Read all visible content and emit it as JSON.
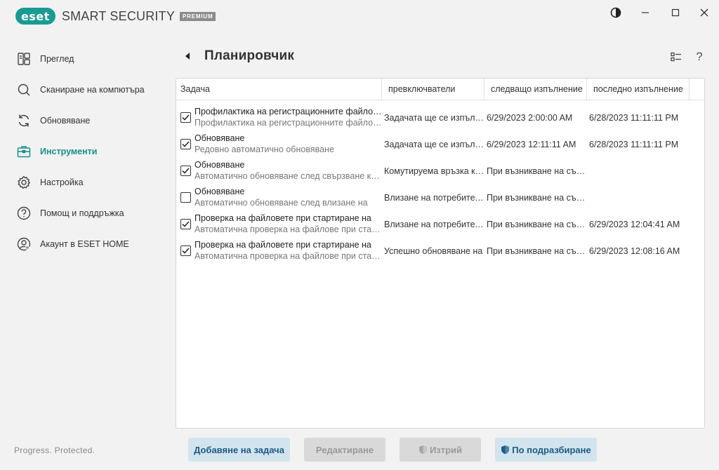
{
  "app": {
    "logo_mark": "eset",
    "product_name": "SMART SECURITY",
    "edition_badge": "PREMIUM",
    "accent_color": "#1a9a92"
  },
  "window_controls": {
    "theme_icon": "contrast-icon",
    "minimize_icon": "minimize-icon",
    "maximize_icon": "maximize-icon",
    "close_icon": "close-icon"
  },
  "sidebar": {
    "items": [
      {
        "label": "Преглед",
        "icon": "overview-icon",
        "active": false
      },
      {
        "label": "Сканиране на компютъра",
        "icon": "search-icon",
        "active": false
      },
      {
        "label": "Обновяване",
        "icon": "refresh-icon",
        "active": false
      },
      {
        "label": "Инструменти",
        "icon": "toolbox-icon",
        "active": true
      },
      {
        "label": "Настройка",
        "icon": "gear-icon",
        "active": false
      },
      {
        "label": "Помощ и поддръжка",
        "icon": "help-icon",
        "active": false
      },
      {
        "label": "Акаунт в ESET HOME",
        "icon": "account-icon",
        "active": false
      }
    ],
    "footer_status": "Progress. Protected."
  },
  "header": {
    "title": "Планировчик",
    "view_icon": "list-view-icon",
    "help_label": "?"
  },
  "table": {
    "columns": [
      "Задача",
      "превключватели",
      "следващо изпълнение",
      "последно изпълнение"
    ],
    "rows": [
      {
        "checked": true,
        "name": "Профилактика на регистрационните файлове",
        "description": "Профилактика на регистрационните файлове",
        "trigger": "Задачата ще се изпълнява",
        "next_run": "6/29/2023 2:00:00 AM",
        "last_run": "6/28/2023 11:11:11 PM"
      },
      {
        "checked": true,
        "name": "Обновяване",
        "description": "Редовно автоматично обновяване",
        "trigger": "Задачата ще се изпълнява",
        "next_run": "6/29/2023 12:11:11 AM",
        "last_run": "6/28/2023 11:11:11 PM"
      },
      {
        "checked": true,
        "name": "Обновяване",
        "description": "Автоматично обновяване след свързване към",
        "trigger": "Комутируема връзка към",
        "next_run": "При възникване на събитие",
        "last_run": ""
      },
      {
        "checked": false,
        "name": "Обновяване",
        "description": "Автоматично обновяване след влизане на",
        "trigger": "Влизане на потребителя",
        "next_run": "При възникване на събитие",
        "last_run": ""
      },
      {
        "checked": true,
        "name": "Проверка на файловете при стартиране на",
        "description": "Автоматична проверка на файлове при стартиране",
        "trigger": "Влизане на потребителя",
        "next_run": "При възникване на събитие",
        "last_run": "6/29/2023 12:04:41 AM"
      },
      {
        "checked": true,
        "name": "Проверка на файловете при стартиране на",
        "description": "Автоматична проверка на файлове при стартиране",
        "trigger": "Успешно обновяване на",
        "next_run": "При възникване на събитие",
        "last_run": "6/29/2023 12:08:16 AM"
      }
    ]
  },
  "actions": {
    "add": "Добавяне на задача",
    "edit": "Редактиране",
    "delete": "Изтрий",
    "default": "По подразбиране"
  }
}
